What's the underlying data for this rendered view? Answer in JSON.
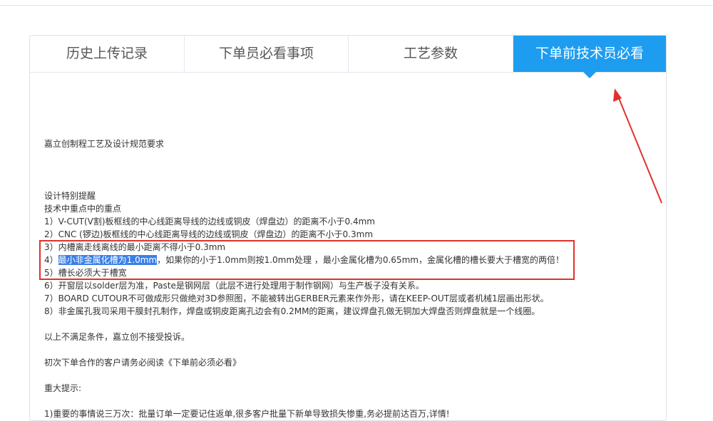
{
  "tabs": [
    {
      "label": "历史上传记录",
      "active": false
    },
    {
      "label": "下单员必看事项",
      "active": false
    },
    {
      "label": "工艺参数",
      "active": false
    },
    {
      "label": "下单前技术员必看",
      "active": true
    }
  ],
  "content": {
    "heading": "嘉立创制程工艺及设计规范要求",
    "notice_title": " 设计特别提醒",
    "focus_title": " 技术中重点中的重点",
    "rule1": "1）V-CUT(V割)板框线的中心线距离导线的边线或铜皮（焊盘边）的距离不小于0.4mm",
    "rule2": "2）CNC (锣边)板框线的中心线距离导线的边线或铜皮（焊盘边）的距离不小于0.3mm",
    "rule3": "3）内槽离走线离线的最小距离不得小于0.3mm",
    "rule4_prefix": "4）",
    "rule4_highlight": "最小非金属化槽为1.0mm",
    "rule4_rest": "，如果你的小于1.0mm则按1.0mm处理 ，最小金属化槽为0.65mm，金属化槽的槽长要大于槽宽的两倍！",
    "rule5": "5）槽长必须大于槽宽",
    "rule6": "6）开窗层以solder层为准，Paste是钢网层（此层不进行处理用于制作钢网）与生产板子没有关系。",
    "rule7": "7）BOARD CUTOUR不可做成形只做绝对3D参照图，不能被转出GERBER元素来作外形，请在KEEP-OUT层或者机械1层画出形状。",
    "rule8": "8）非金属孔我司采用干膜封孔制作，焊盘或铜皮距离孔边会有0.2MM的距离，建议焊盘孔做无铜加大焊盘否则焊盘就是一个线圈。",
    "not_accept": "以上不满足条件，嘉立创不接受投诉。",
    "first_order": "初次下单合作的客户请务必阅读《下单前必须必看》",
    "important": "重大提示:",
    "last_line": "1)重要的事情说三万次：批量订单一定要记住返单,很多客户批量下新单导致损失惨重,务必提前达百万,详情!"
  },
  "colors": {
    "accent": "#1e9df0",
    "annotation_red": "#e0312b",
    "selection": "#3a80e6"
  }
}
